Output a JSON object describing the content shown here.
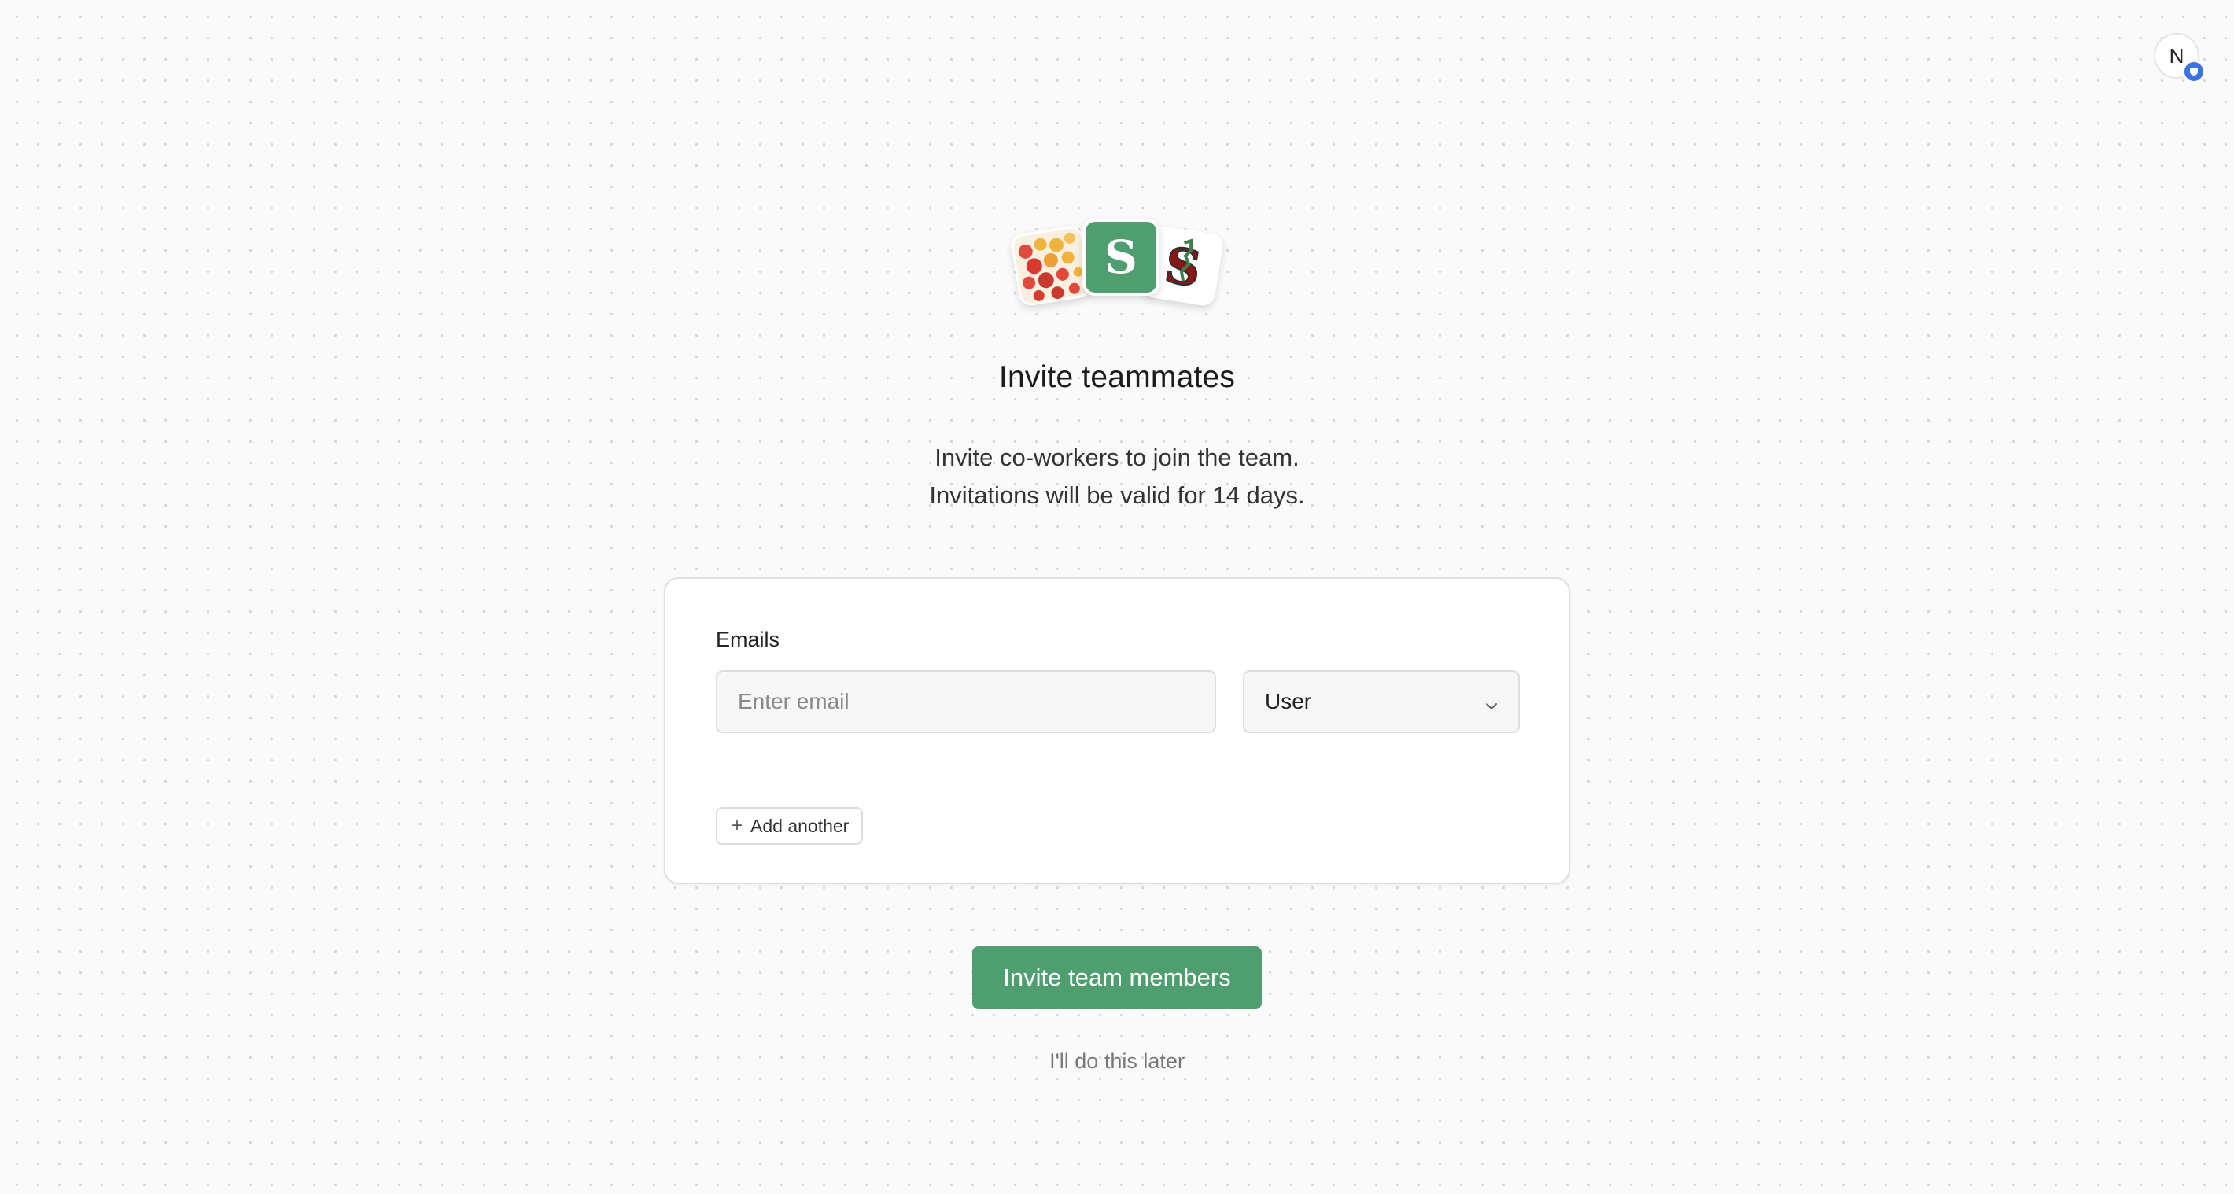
{
  "header": {
    "avatar_initial": "N",
    "avatar_badge_icon": "shield-icon",
    "avatar_badge_color": "#3b73e0"
  },
  "logos": [
    {
      "name": "polka-dot-logo",
      "colors": [
        "#e94b3c",
        "#f0b43c",
        "#c93a2e"
      ]
    },
    {
      "name": "s-logo",
      "letter": "S",
      "color": "#4f9e6f"
    },
    {
      "name": "block-s-logo",
      "color": "#8c1515"
    }
  ],
  "main": {
    "title": "Invite teammates",
    "subtitle_line1": "Invite co-workers to join the team.",
    "subtitle_line2": "Invitations will be valid for 14 days."
  },
  "form": {
    "emails_label": "Emails",
    "email_placeholder": "Enter email",
    "email_value": "",
    "role_value": "User",
    "add_another_label": "Add another"
  },
  "actions": {
    "invite_label": "Invite team members",
    "later_label": "I'll do this later",
    "accent_color": "#4f9e6f"
  }
}
